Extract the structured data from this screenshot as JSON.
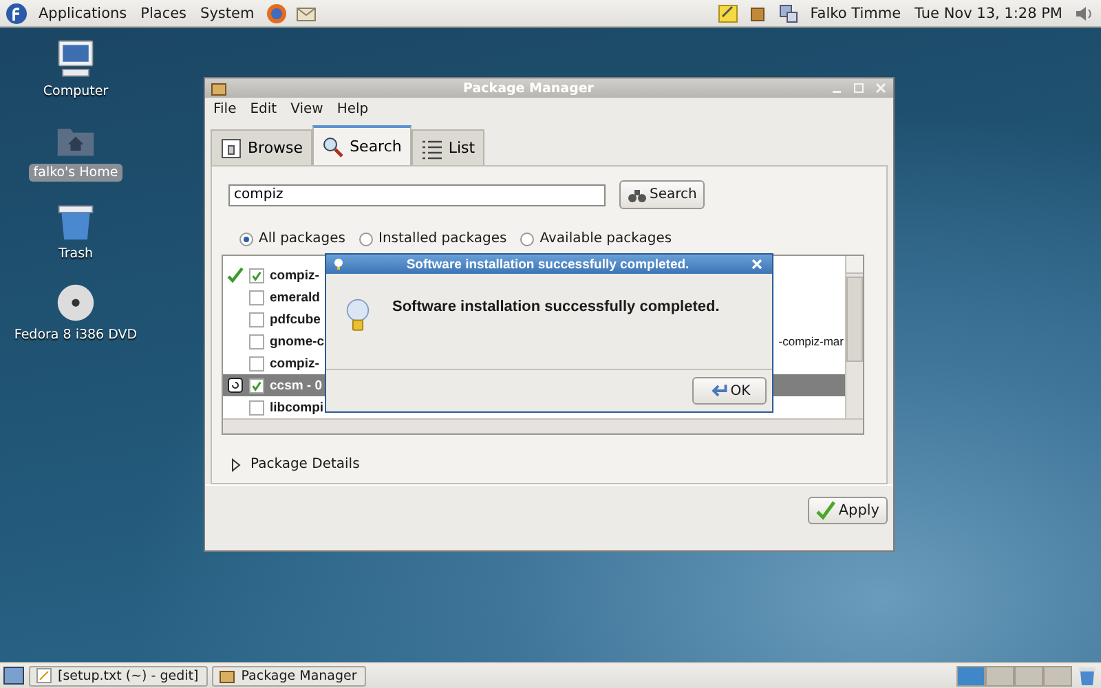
{
  "top_panel": {
    "menus": [
      "Applications",
      "Places",
      "System"
    ],
    "user": "Falko Timme",
    "clock": "Tue Nov 13,  1:28 PM"
  },
  "desktop_icons": [
    {
      "label": "Computer",
      "kind": "computer",
      "selected": false
    },
    {
      "label": "falko's Home",
      "kind": "home",
      "selected": true
    },
    {
      "label": "Trash",
      "kind": "trash",
      "selected": false
    },
    {
      "label": "Fedora 8 i386 DVD",
      "kind": "disc",
      "selected": false
    }
  ],
  "window": {
    "title": "Package Manager",
    "menu": [
      "File",
      "Edit",
      "View",
      "Help"
    ],
    "tabs": [
      {
        "label": "Browse",
        "kind": "browse",
        "selected": false
      },
      {
        "label": "Search",
        "kind": "search",
        "selected": true
      },
      {
        "label": "List",
        "kind": "list",
        "selected": false
      }
    ],
    "search": {
      "value": "compiz",
      "button": "Search"
    },
    "filters": [
      {
        "label": "All packages",
        "selected": true
      },
      {
        "label": "Installed packages",
        "selected": false
      },
      {
        "label": "Available packages",
        "selected": false
      }
    ],
    "packages": [
      {
        "name": "compiz-",
        "checked": true,
        "kind": "installed",
        "selected": false
      },
      {
        "name": "emerald",
        "checked": false,
        "kind": "plain",
        "selected": false
      },
      {
        "name": "pdfcube",
        "checked": false,
        "kind": "plain",
        "selected": false
      },
      {
        "name": "gnome-c",
        "checked": false,
        "kind": "plain",
        "selected": false,
        "column_2": "-compiz-mar"
      },
      {
        "name": "compiz-",
        "checked": false,
        "kind": "plain",
        "selected": false
      },
      {
        "name": "ccsm - 0",
        "checked": true,
        "kind": "changed",
        "selected": true
      },
      {
        "name": "libcompi",
        "checked": false,
        "kind": "plain",
        "selected": false
      }
    ],
    "details": {
      "label": "Package Details",
      "expanded": false
    },
    "apply_button": "Apply"
  },
  "dialog": {
    "title": "Software installation successfully completed.",
    "message": "Software installation successfully completed.",
    "ok_button": "OK"
  },
  "taskbar": {
    "tasks": [
      {
        "label": "[setup.txt (~) - gedit]",
        "kind": "editor"
      },
      {
        "label": "Package Manager",
        "kind": "package"
      }
    ],
    "workspaces": [
      {
        "selected": true
      },
      {
        "selected": false
      },
      {
        "selected": false
      },
      {
        "selected": false
      }
    ]
  }
}
